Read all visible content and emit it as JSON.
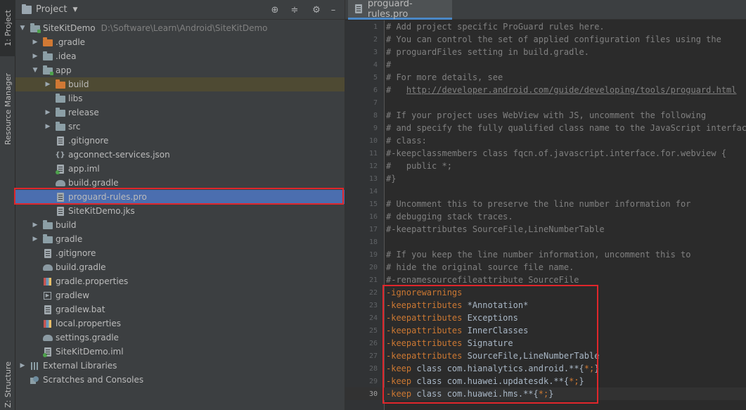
{
  "sidebar_tabs": {
    "project": "1: Project",
    "resource_manager": "Resource Manager",
    "structure": "Z: Structure"
  },
  "project_panel": {
    "title": "Project",
    "header_icons": [
      "locate-icon",
      "collapse-icon",
      "gear-icon",
      "hide-icon"
    ]
  },
  "tree": [
    {
      "label": "SiteKitDemo",
      "path": "D:\\Software\\Learn\\Android\\SiteKitDemo"
    },
    {
      "label": ".gradle"
    },
    {
      "label": ".idea"
    },
    {
      "label": "app"
    },
    {
      "label": "build"
    },
    {
      "label": "libs"
    },
    {
      "label": "release"
    },
    {
      "label": "src"
    },
    {
      "label": ".gitignore"
    },
    {
      "label": "agconnect-services.json"
    },
    {
      "label": "app.iml"
    },
    {
      "label": "build.gradle"
    },
    {
      "label": "proguard-rules.pro"
    },
    {
      "label": "SiteKitDemo.jks"
    },
    {
      "label": "build"
    },
    {
      "label": "gradle"
    },
    {
      "label": ".gitignore"
    },
    {
      "label": "build.gradle"
    },
    {
      "label": "gradle.properties"
    },
    {
      "label": "gradlew"
    },
    {
      "label": "gradlew.bat"
    },
    {
      "label": "local.properties"
    },
    {
      "label": "settings.gradle"
    },
    {
      "label": "SiteKitDemo.iml"
    },
    {
      "label": "External Libraries"
    },
    {
      "label": "Scratches and Consoles"
    }
  ],
  "editor": {
    "tab_label": "proguard-rules.pro",
    "current_line": 30,
    "lines": [
      {
        "n": "1",
        "parts": [
          [
            "cm",
            "# Add project specific ProGuard rules here."
          ]
        ]
      },
      {
        "n": "2",
        "parts": [
          [
            "cm",
            "# You can control the set of applied configuration files using the"
          ]
        ]
      },
      {
        "n": "3",
        "parts": [
          [
            "cm",
            "# proguardFiles setting in build.gradle."
          ]
        ]
      },
      {
        "n": "4",
        "parts": [
          [
            "cm",
            "#"
          ]
        ]
      },
      {
        "n": "5",
        "parts": [
          [
            "cm",
            "# For more details, see"
          ]
        ]
      },
      {
        "n": "6",
        "parts": [
          [
            "cm",
            "#   "
          ],
          [
            "url",
            "http://developer.android.com/guide/developing/tools/proguard.html"
          ]
        ]
      },
      {
        "n": "7",
        "parts": []
      },
      {
        "n": "8",
        "parts": [
          [
            "cm",
            "# If your project uses WebView with JS, uncomment the following"
          ]
        ]
      },
      {
        "n": "9",
        "parts": [
          [
            "cm",
            "# and specify the fully qualified class name to the JavaScript interface"
          ]
        ]
      },
      {
        "n": "10",
        "parts": [
          [
            "cm",
            "# class:"
          ]
        ]
      },
      {
        "n": "11",
        "parts": [
          [
            "cm",
            "#-keepclassmembers class fqcn.of.javascript.interface.for.webview {"
          ]
        ]
      },
      {
        "n": "12",
        "parts": [
          [
            "cm",
            "#   public *;"
          ]
        ]
      },
      {
        "n": "13",
        "parts": [
          [
            "cm",
            "#}"
          ]
        ]
      },
      {
        "n": "14",
        "parts": []
      },
      {
        "n": "15",
        "parts": [
          [
            "cm",
            "# Uncomment this to preserve the line number information for"
          ]
        ]
      },
      {
        "n": "16",
        "parts": [
          [
            "cm",
            "# debugging stack traces."
          ]
        ]
      },
      {
        "n": "17",
        "parts": [
          [
            "cm",
            "#-keepattributes SourceFile,LineNumberTable"
          ]
        ]
      },
      {
        "n": "18",
        "parts": []
      },
      {
        "n": "19",
        "parts": [
          [
            "cm",
            "# If you keep the line number information, uncomment this to"
          ]
        ]
      },
      {
        "n": "20",
        "parts": [
          [
            "cm",
            "# hide the original source file name."
          ]
        ]
      },
      {
        "n": "21",
        "parts": [
          [
            "cm",
            "#-renamesourcefileattribute SourceFile"
          ]
        ]
      },
      {
        "n": "22",
        "parts": [
          [
            "kw",
            "-ignorewarnings"
          ]
        ]
      },
      {
        "n": "23",
        "parts": [
          [
            "kw",
            "-keepattributes"
          ],
          [
            "pl",
            " *Annotation*"
          ]
        ]
      },
      {
        "n": "24",
        "parts": [
          [
            "kw",
            "-keepattributes"
          ],
          [
            "pl",
            " Exceptions"
          ]
        ]
      },
      {
        "n": "25",
        "parts": [
          [
            "kw",
            "-keepattributes"
          ],
          [
            "pl",
            " InnerClasses"
          ]
        ]
      },
      {
        "n": "26",
        "parts": [
          [
            "kw",
            "-keepattributes"
          ],
          [
            "pl",
            " Signature"
          ]
        ]
      },
      {
        "n": "27",
        "parts": [
          [
            "kw",
            "-keepattributes"
          ],
          [
            "pl",
            " SourceFile,LineNumberTable"
          ]
        ]
      },
      {
        "n": "28",
        "parts": [
          [
            "kw",
            "-keep"
          ],
          [
            "pl",
            " class com.hianalytics.android.**{"
          ],
          [
            "kw",
            "*;"
          ],
          [
            "pl",
            "}"
          ]
        ]
      },
      {
        "n": "29",
        "parts": [
          [
            "kw",
            "-keep"
          ],
          [
            "pl",
            " class com.huawei.updatesdk.**{"
          ],
          [
            "kw",
            "*;"
          ],
          [
            "pl",
            "}"
          ]
        ]
      },
      {
        "n": "30",
        "parts": [
          [
            "kw",
            "-keep"
          ],
          [
            "pl",
            " class com.huawei.hms.**{"
          ],
          [
            "kw",
            "*;"
          ],
          [
            "pl",
            "}"
          ]
        ]
      }
    ]
  },
  "colors": {
    "selection": "#4b6eaf",
    "highlight_box": "#e0262b",
    "keyword": "#cc7832",
    "comment": "#808080"
  }
}
